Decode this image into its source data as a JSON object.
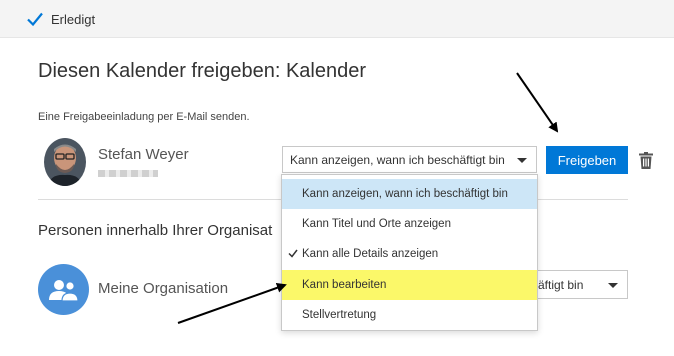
{
  "topbar": {
    "done_label": "Erledigt"
  },
  "dialog": {
    "title": "Diesen Kalender freigeben: Kalender",
    "subtitle": "Eine Freigabeeinladung per E-Mail senden."
  },
  "person": {
    "name": "Stefan Weyer",
    "permission": "Kann anzeigen, wann ich beschäftigt bin"
  },
  "share_button": "Freigeben",
  "section": {
    "title": "Personen innerhalb Ihrer Organisat",
    "org_name": "Meine Organisation",
    "org_permission": "äftigt bin"
  },
  "dropdown": {
    "options": [
      {
        "label": "Kann anzeigen, wann ich beschäftigt bin",
        "state": "selected"
      },
      {
        "label": "Kann Titel und Orte anzeigen",
        "state": ""
      },
      {
        "label": "Kann alle Details anzeigen",
        "state": "checked"
      },
      {
        "label": "Kann bearbeiten",
        "state": "highlighted"
      },
      {
        "label": "Stellvertretung",
        "state": ""
      }
    ]
  },
  "colors": {
    "accent": "#0078d7",
    "selected_option": "#cde6f7",
    "highlight": "#fbf869",
    "org_icon": "#4a90d9"
  },
  "icons": [
    "checkmark-icon",
    "trash-icon",
    "people-icon",
    "chevron-down-icon"
  ]
}
